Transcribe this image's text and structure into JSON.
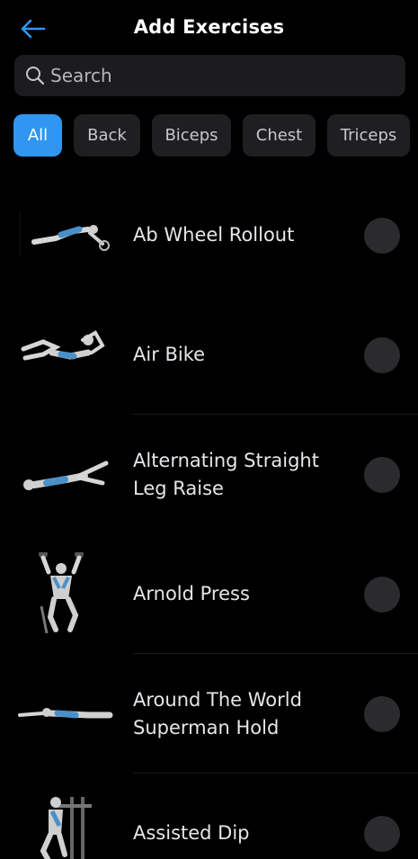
{
  "header": {
    "title": "Add Exercises",
    "back_icon": "arrow-left-icon",
    "accent": "#2f97f2"
  },
  "search": {
    "placeholder": "Search",
    "value": ""
  },
  "filters": [
    {
      "label": "All",
      "selected": true
    },
    {
      "label": "Back",
      "selected": false
    },
    {
      "label": "Biceps",
      "selected": false
    },
    {
      "label": "Chest",
      "selected": false
    },
    {
      "label": "Triceps",
      "selected": false
    }
  ],
  "exercises": [
    {
      "name": "Ab Wheel Rollout",
      "selected": false
    },
    {
      "name": "Air Bike",
      "selected": false
    },
    {
      "name": "Alternating Straight Leg Raise",
      "selected": false
    },
    {
      "name": "Arnold Press",
      "selected": false
    },
    {
      "name": "Around The World Superman Hold",
      "selected": false
    },
    {
      "name": "Assisted Dip",
      "selected": false
    }
  ]
}
